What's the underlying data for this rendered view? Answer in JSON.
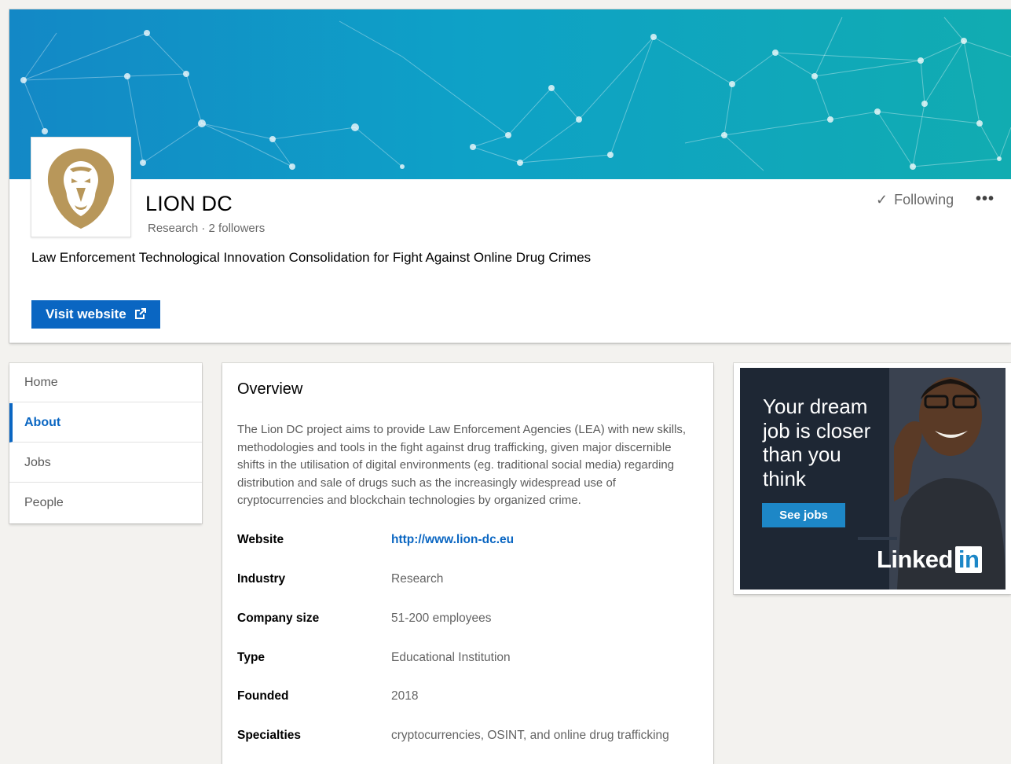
{
  "company": {
    "name": "LION DC",
    "industry": "Research",
    "separator": "·",
    "followers": "2 followers",
    "tagline": "Law Enforcement Technological Innovation Consolidation for Fight Against Online Drug Crimes",
    "visit_website_label": "Visit website",
    "following_label": "Following",
    "more_label": "•••"
  },
  "nav": {
    "items": [
      {
        "label": "Home"
      },
      {
        "label": "About"
      },
      {
        "label": "Jobs"
      },
      {
        "label": "People"
      }
    ]
  },
  "overview": {
    "title": "Overview",
    "description": "The Lion DC project aims to provide Law Enforcement Agencies (LEA) with new skills, methodologies and tools in the fight against drug trafficking, given major discernible shifts in the utilisation of digital environments (eg. traditional social media) regarding distribution and sale of drugs such as the increasingly widespread use of cryptocurrencies and blockchain technologies by organized crime.",
    "rows": [
      {
        "key": "Website",
        "value": "http://www.lion-dc.eu"
      },
      {
        "key": "Industry",
        "value": "Research"
      },
      {
        "key": "Company size",
        "value": "51-200 employees"
      },
      {
        "key": "Type",
        "value": "Educational Institution"
      },
      {
        "key": "Founded",
        "value": "2018"
      },
      {
        "key": "Specialties",
        "value": "cryptocurrencies, OSINT, and online drug trafficking"
      }
    ]
  },
  "ad": {
    "headline": "Your dream job is closer than you think",
    "button_label": "See jobs",
    "brand_left": "Linked",
    "brand_right": "in"
  },
  "colors": {
    "accent": "#0a66c2",
    "banner_start": "#1388c6",
    "banner_end": "#11acb1",
    "logo_gold": "#b8975a"
  },
  "icons": {
    "check": "check-icon",
    "external": "external-link-icon",
    "more": "more-icon",
    "logo": "lion-logo"
  }
}
